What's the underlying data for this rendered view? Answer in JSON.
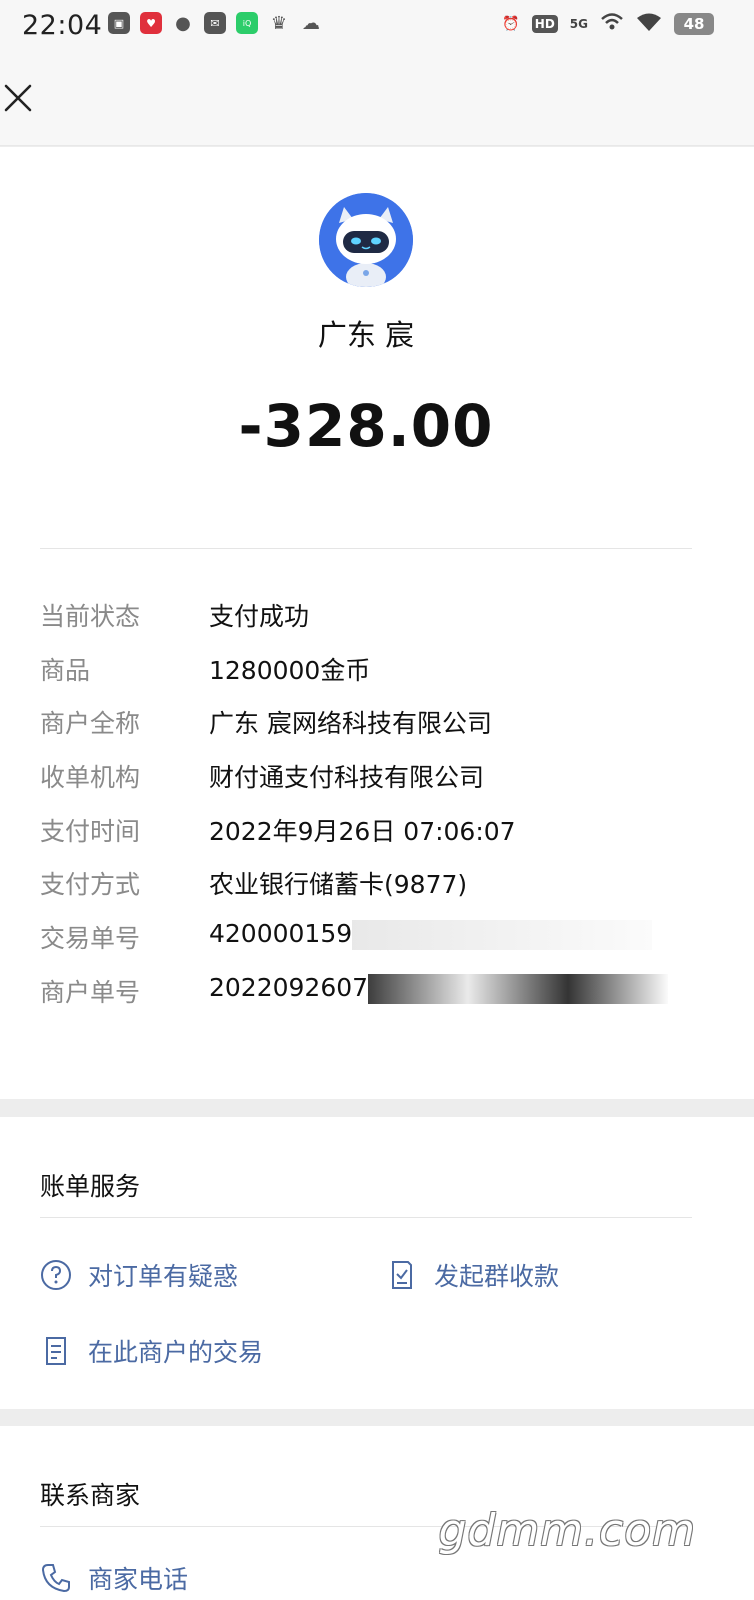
{
  "status_bar": {
    "time": "22:04",
    "network": "5G",
    "hd": "HD",
    "battery": "48"
  },
  "merchant": {
    "name": "广东 宸",
    "amount": "-328.00"
  },
  "details": [
    {
      "label": "当前状态",
      "value": "支付成功"
    },
    {
      "label": "商品",
      "value": "1280000金币"
    },
    {
      "label": "商户全称",
      "value": "广东 宸网络科技有限公司"
    },
    {
      "label": "收单机构",
      "value": "财付通支付科技有限公司"
    },
    {
      "label": "支付时间",
      "value": "2022年9月26日 07:06:07"
    },
    {
      "label": "支付方式",
      "value": "农业银行储蓄卡(9877)"
    },
    {
      "label": "交易单号",
      "value": "420000159"
    },
    {
      "label": "商户单号",
      "value": "2022092607"
    }
  ],
  "bill_services": {
    "title": "账单服务",
    "items": [
      {
        "label": "对订单有疑惑",
        "icon": "question-circle-icon"
      },
      {
        "label": "发起群收款",
        "icon": "receipt-check-icon"
      },
      {
        "label": "在此商户的交易",
        "icon": "document-list-icon"
      }
    ]
  },
  "contact": {
    "title": "联系商家",
    "phone_label": "商家电话",
    "phone_icon": "phone-icon"
  },
  "watermark": "gdmm.com",
  "colors": {
    "link": "#4b6aa3",
    "avatar_bg": "#3e73e8",
    "label_gray": "#8a8a8a"
  }
}
